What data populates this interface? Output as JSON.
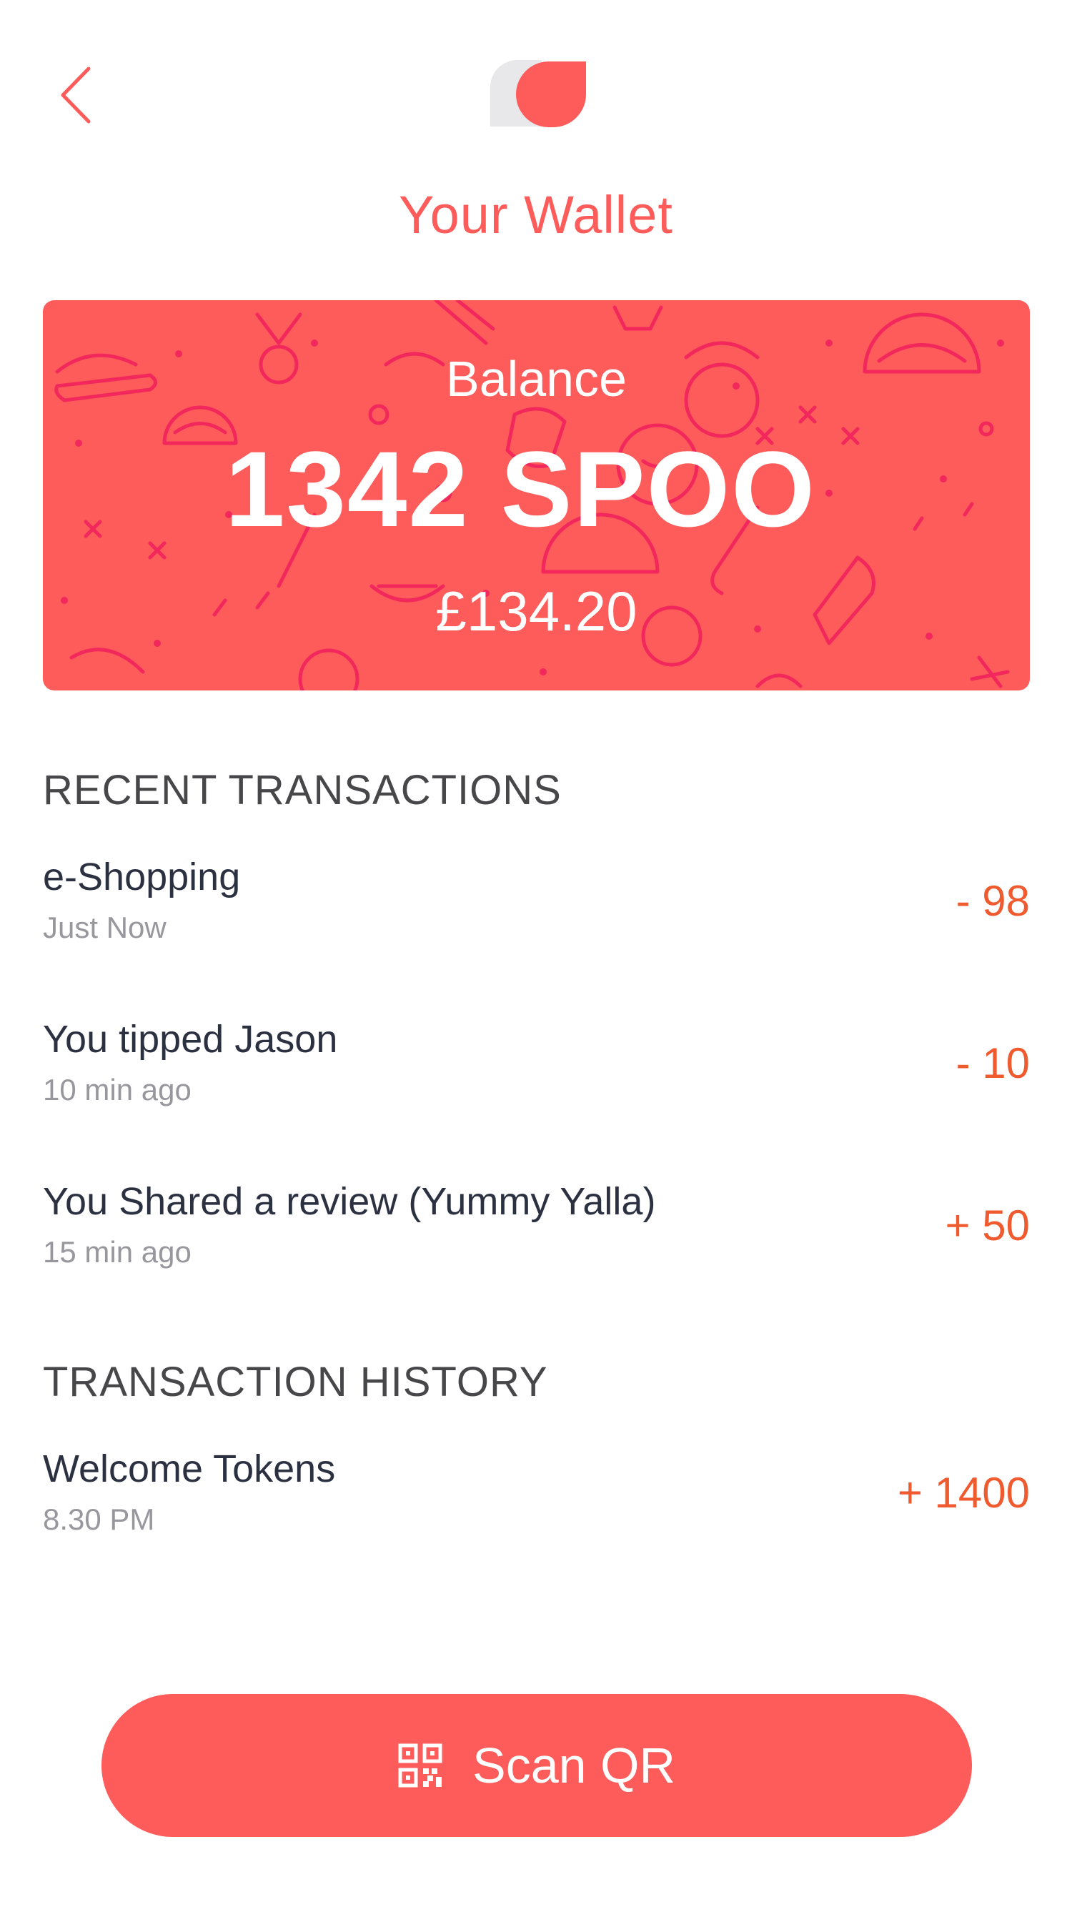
{
  "colors": {
    "accent": "#fe5c5a",
    "card_pattern": "#f01f5e",
    "amount": "#f05a2f",
    "logo_gray": "#e8e8ea"
  },
  "header": {
    "back_icon": "chevron-left-icon",
    "logo_icon": "app-logo-icon",
    "title": "Your Wallet"
  },
  "balance": {
    "label": "Balance",
    "amount": "1342 SPOO",
    "fiat": "£134.20"
  },
  "recent": {
    "heading": "RECENT TRANSACTIONS",
    "items": [
      {
        "title": "e-Shopping",
        "time": "Just Now",
        "amount": "- 98"
      },
      {
        "title": "You tipped Jason",
        "time": "10 min ago",
        "amount": "- 10"
      },
      {
        "title": "You Shared a review (Yummy Yalla)",
        "time": "15 min ago",
        "amount": "+ 50"
      }
    ]
  },
  "history": {
    "heading": "TRANSACTION HISTORY",
    "items": [
      {
        "title": "Welcome Tokens",
        "time": "8.30 PM",
        "amount": "+ 1400"
      }
    ]
  },
  "scan_button": {
    "icon": "qr-code-icon",
    "label": "Scan QR"
  }
}
